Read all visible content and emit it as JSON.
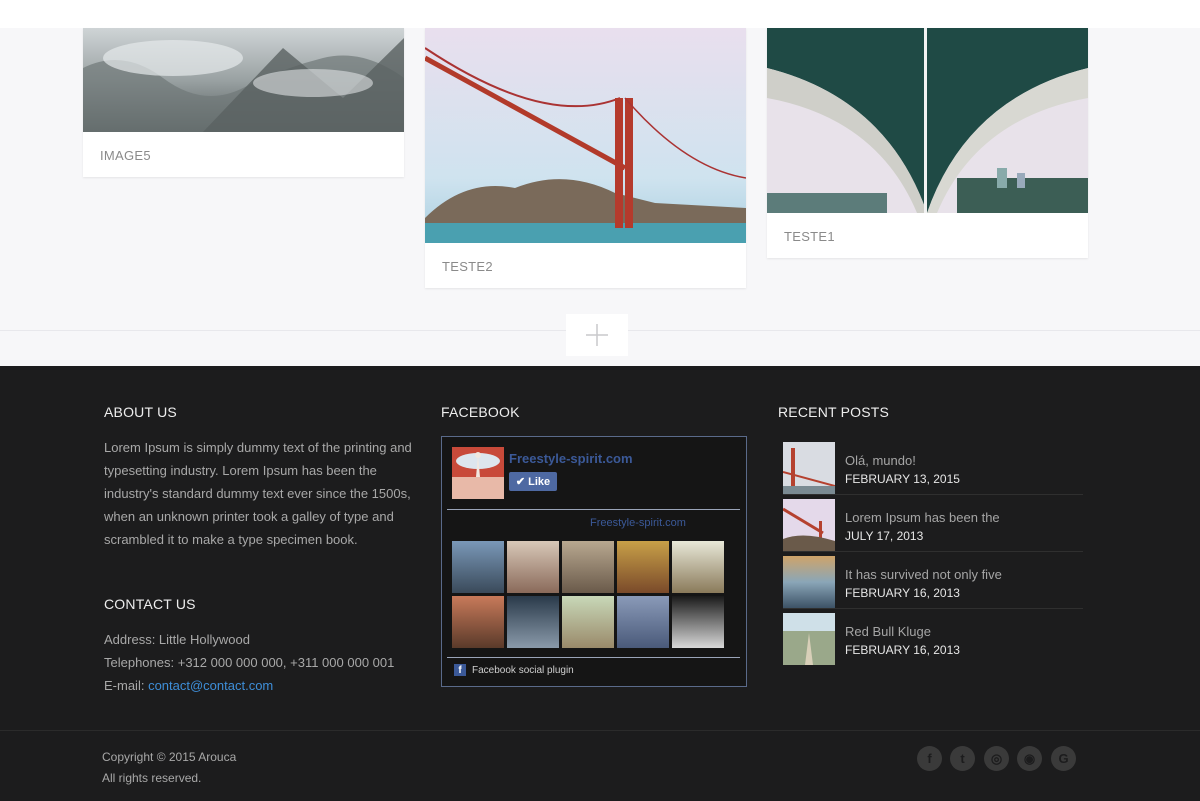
{
  "gallery": {
    "cards": [
      {
        "caption": "IMAGE5"
      },
      {
        "caption": "TESTE2"
      },
      {
        "caption": "TESTE1"
      }
    ]
  },
  "footer": {
    "about": {
      "title": "ABOUT US",
      "text": "Lorem Ipsum is simply dummy text of the printing and typesetting industry. Lorem Ipsum has been the industry's standard dummy text ever since the 1500s, when an unknown printer took a galley of type and scrambled it to make a type specimen book."
    },
    "contact": {
      "title": "CONTACT US",
      "address": "Address: Little Hollywood",
      "telephones": "Telephones: +312 000 000 000, +311 000 000 001",
      "email_label": "E-mail: ",
      "email": "contact@contact.com"
    },
    "facebook": {
      "title": "FACEBOOK",
      "page_name": "Freestyle-spirit.com",
      "like_label": "Like",
      "subline": "Freestyle-spirit.com",
      "plugin_label": "Facebook social plugin"
    },
    "recent_posts": {
      "title": "RECENT POSTS",
      "items": [
        {
          "title": "Olá, mundo!",
          "date": "FEBRUARY 13, 2015"
        },
        {
          "title": "Lorem Ipsum has been the",
          "date": "JULY 17, 2013"
        },
        {
          "title": "It has survived not only five",
          "date": "FEBRUARY 16, 2013"
        },
        {
          "title": "Red Bull Kluge",
          "date": "FEBRUARY 16, 2013"
        }
      ]
    }
  },
  "bottom": {
    "copyright": "Copyright © 2015 Arouca",
    "rights": "All rights reserved.",
    "social_icons": [
      "facebook-icon",
      "twitter-icon",
      "dribbble-icon",
      "rss-icon",
      "google-icon"
    ]
  }
}
